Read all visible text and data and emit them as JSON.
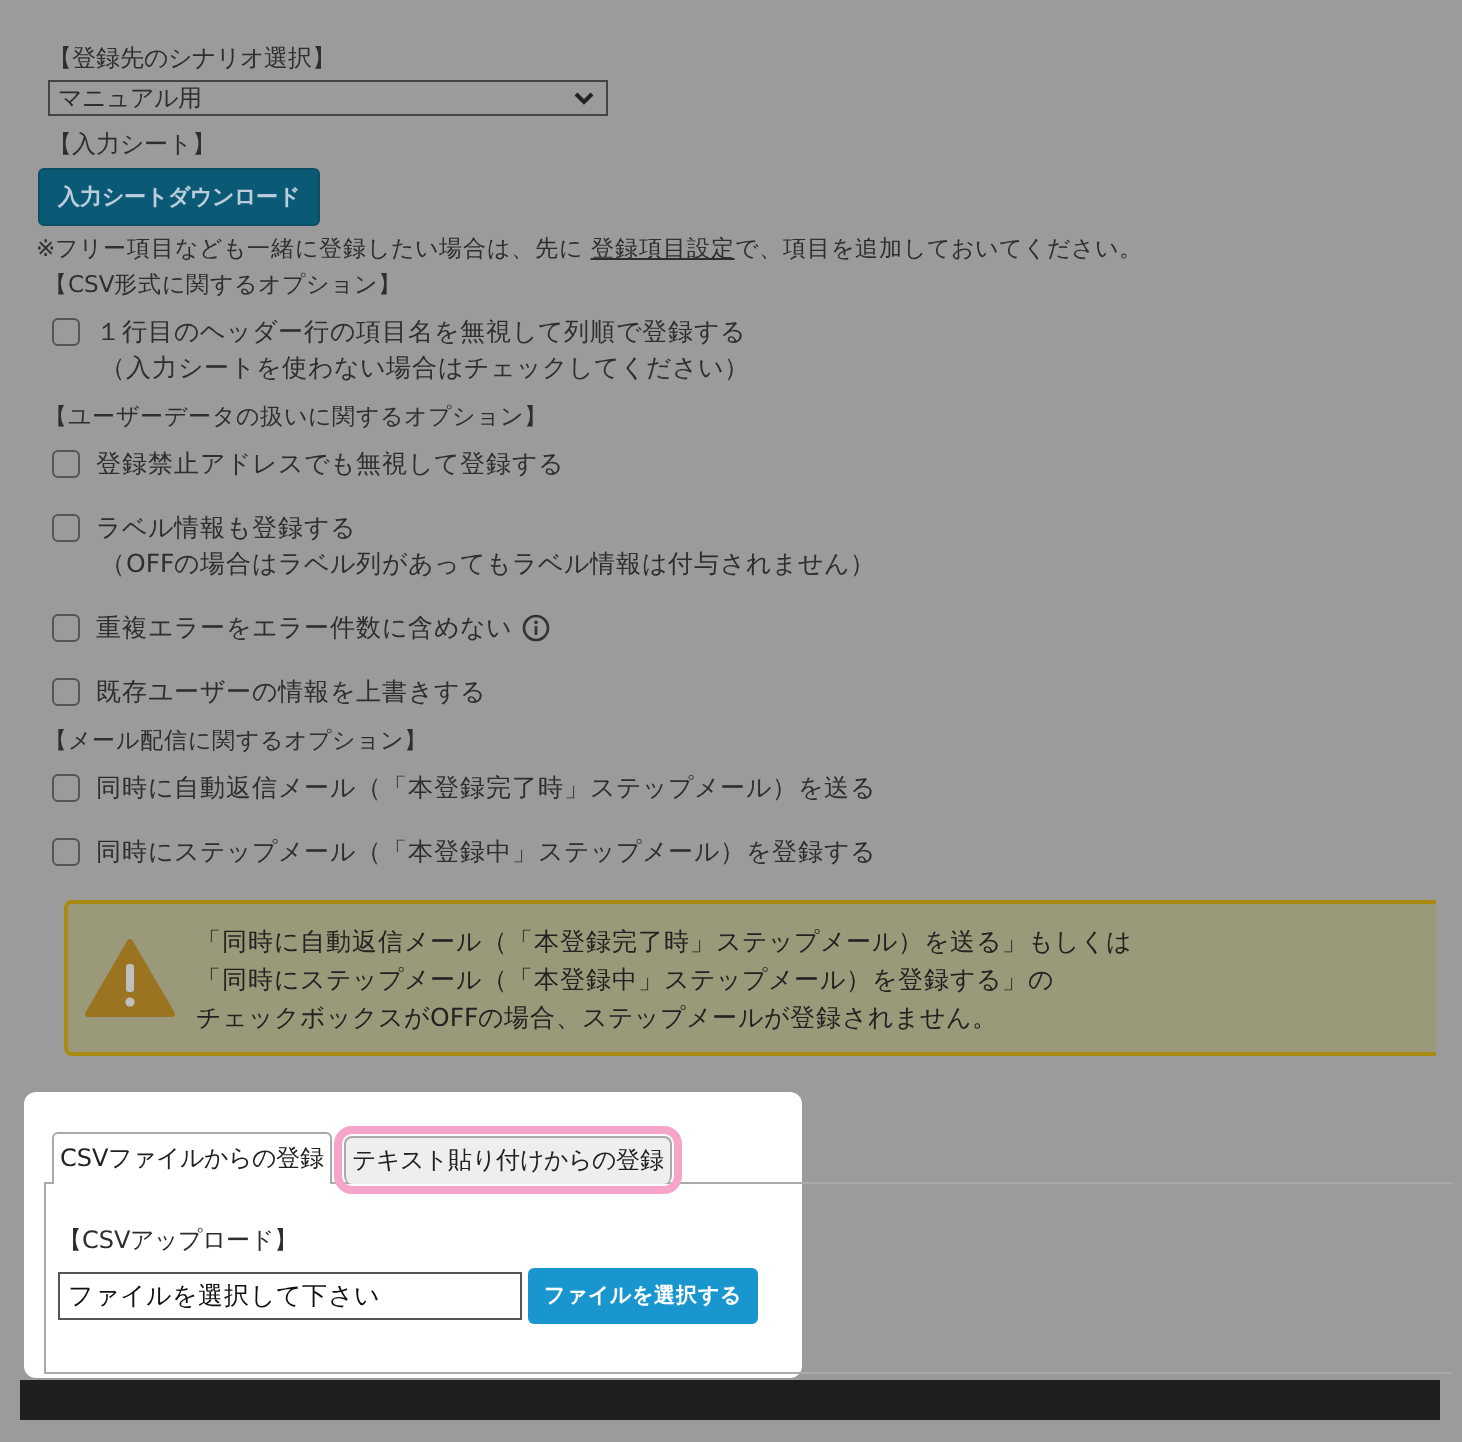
{
  "scenario": {
    "label": "【登録先のシナリオ選択】",
    "value": "マニュアル用"
  },
  "sheet": {
    "label": "【入力シート】",
    "button": "入力シートダウンロード"
  },
  "note": {
    "before": "※フリー項目なども一緒に登録したい場合は、先に ",
    "link": "登録項目設定",
    "after": "で、項目を追加しておいてください。"
  },
  "option_groups": [
    {
      "heading": "【CSV形式に関するオプション】",
      "items": [
        {
          "label": "１行目のヘッダー行の項目名を無視して列順で登録する",
          "sub": "（入力シートを使わない場合はチェックしてください）",
          "info": false,
          "checked": false
        }
      ]
    },
    {
      "heading": "【ユーザーデータの扱いに関するオプション】",
      "items": [
        {
          "label": "登録禁止アドレスでも無視して登録する",
          "info": false,
          "checked": false
        },
        {
          "label": "ラベル情報も登録する",
          "sub": "（OFFの場合はラベル列があってもラベル情報は付与されません）",
          "info": false,
          "checked": false
        },
        {
          "label": "重複エラーをエラー件数に含めない",
          "info": true,
          "checked": false
        },
        {
          "label": "既存ユーザーの情報を上書きする",
          "info": false,
          "checked": false
        }
      ]
    },
    {
      "heading": "【メール配信に関するオプション】",
      "items": [
        {
          "label": "同時に自動返信メール（「本登録完了時」ステップメール）を送る",
          "info": false,
          "checked": false
        },
        {
          "label": "同時にステップメール（「本登録中」ステップメール）を登録する",
          "info": false,
          "checked": false
        }
      ]
    }
  ],
  "warning": {
    "lines": [
      "「同時に自動返信メール（「本登録完了時」ステップメール）を送る」もしくは",
      "「同時にステップメール（「本登録中」ステップメール）を登録する」の",
      "チェックボックスがOFFの場合、ステップメールが登録されません。"
    ]
  },
  "tabs": [
    {
      "label": "CSVファイルからの登録",
      "selected": true,
      "highlighted": false
    },
    {
      "label": "テキスト貼り付けからの登録",
      "selected": false,
      "highlighted": true
    }
  ],
  "upload": {
    "label": "【CSVアップロード】",
    "value": "ファイルを選択して下さい",
    "button": "ファイルを選択する"
  }
}
